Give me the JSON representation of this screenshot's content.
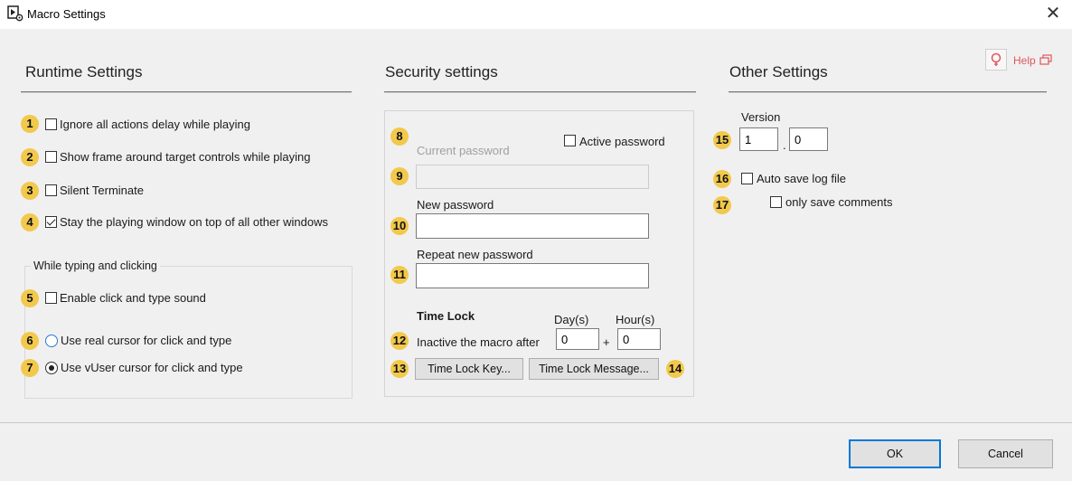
{
  "window": {
    "title": "Macro Settings",
    "close_glyph": "✕"
  },
  "help": {
    "label": "Help",
    "icon": "help-icon"
  },
  "runtime": {
    "title": "Runtime Settings",
    "options": [
      {
        "badge": "1",
        "label": "Ignore all actions delay while playing",
        "checked": false
      },
      {
        "badge": "2",
        "label": "Show frame around target controls while playing",
        "checked": false
      },
      {
        "badge": "3",
        "label": "Silent Terminate",
        "checked": false
      },
      {
        "badge": "4",
        "label": "Stay the playing window on top of all other windows",
        "checked": true
      }
    ],
    "group": {
      "legend": "While typing and clicking",
      "sound": {
        "badge": "5",
        "label": "Enable click and type sound",
        "checked": false
      },
      "real_cursor": {
        "badge": "6",
        "label": "Use real cursor for click and type",
        "selected": false
      },
      "vuser_cursor": {
        "badge": "7",
        "label": "Use vUser cursor for click and type",
        "selected": true
      }
    }
  },
  "security": {
    "title": "Security settings",
    "current_password_badge": "8",
    "current_password_label": "Current password",
    "active_password_label": "Active password",
    "current_password_input_badge": "9",
    "current_password_value": "",
    "new_password_badge": "10",
    "new_password_label": "New password",
    "new_password_value": "",
    "repeat_password_badge": "11",
    "repeat_password_label": "Repeat new password",
    "repeat_password_value": "",
    "time_lock": {
      "title": "Time Lock",
      "days_label": "Day(s)",
      "hours_label": "Hour(s)",
      "badge": "12",
      "inactive_label": "Inactive the macro after",
      "days_value": "0",
      "plus": "+",
      "hours_value": "0",
      "key_badge": "13",
      "key_button": "Time Lock Key...",
      "message_button": "Time Lock Message...",
      "message_badge": "14"
    }
  },
  "other": {
    "title": "Other Settings",
    "version_badge": "15",
    "version_label": "Version",
    "version_major": "1",
    "version_dot": ".",
    "version_minor": "0",
    "autosave_badge": "16",
    "autosave_label": "Auto save log file",
    "comments_badge": "17",
    "comments_label": "only save comments"
  },
  "footer": {
    "ok": "OK",
    "cancel": "Cancel"
  }
}
